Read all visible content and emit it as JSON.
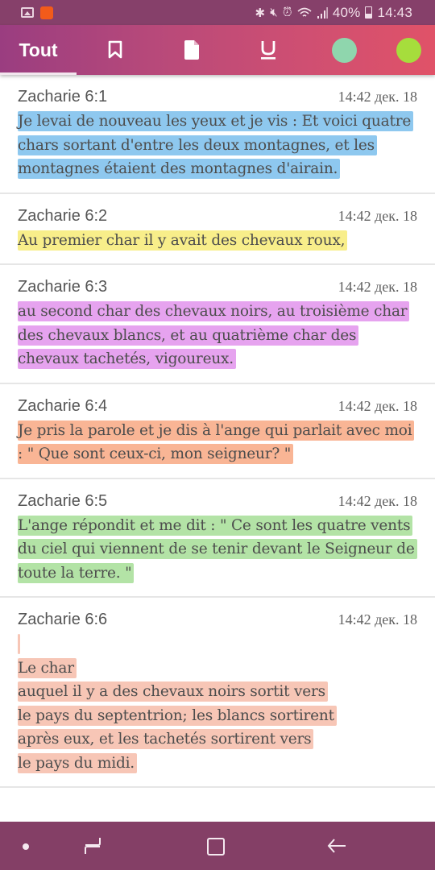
{
  "status_bar": {
    "battery": "40%",
    "time": "14:43",
    "icons": [
      "gallery-icon",
      "app-notification-icon",
      "bluetooth-icon",
      "mute-icon",
      "alarm-icon",
      "wifi-icon",
      "signal-icon",
      "battery-icon"
    ]
  },
  "tabs": [
    {
      "label": "Tout",
      "icon": null,
      "selected": true
    },
    {
      "label": "",
      "icon": "bookmark-icon",
      "selected": false
    },
    {
      "label": "",
      "icon": "note-icon",
      "selected": false
    },
    {
      "label": "",
      "icon": "underline-icon",
      "selected": false
    },
    {
      "label": "",
      "icon": "color-filter-icon",
      "color": "#8fd6ad",
      "selected": false
    },
    {
      "label": "",
      "icon": "color-filter-icon",
      "color": "#a6dd3c",
      "selected": false
    }
  ],
  "colors": {
    "blue": "#8ec8ef",
    "yellow": "#f8ee8a",
    "purple": "#e6a3ef",
    "orange": "#f9b595",
    "green": "#b3e3a6",
    "salmon": "#f7c6b6"
  },
  "items": [
    {
      "ref": "Zacharie 6:1",
      "time": "14:42 дек. 18",
      "highlight": "#8ec8ef",
      "text": "Je levai de nouveau les yeux et je vis : Et voici quatre chars sortant d'entre les deux montagnes, et les montagnes étaient des montagnes d'airain."
    },
    {
      "ref": "Zacharie 6:2",
      "time": "14:42 дек. 18",
      "highlight": "#f8ee8a",
      "text": "Au premier char il y avait des chevaux roux,"
    },
    {
      "ref": "Zacharie 6:3",
      "time": "14:42 дек. 18",
      "highlight": "#e6a3ef",
      "text": "au second char des chevaux noirs, au troisième char des chevaux blancs, et au quatrième char des chevaux tachetés, vigoureux."
    },
    {
      "ref": "Zacharie 6:4",
      "time": "14:42 дек. 18",
      "highlight": "#f9b595",
      "text": "Je pris la parole et je dis à l'ange qui parlait avec moi : \" Que sont ceux-ci, mon seigneur? \""
    },
    {
      "ref": "Zacharie 6:5",
      "time": "14:42 дек. 18",
      "highlight": "#b3e3a6",
      "text": "L'ange répondit et me dit : \" Ce sont les quatre vents du ciel qui viennent de se tenir devant le Seigneur de toute la terre. \""
    },
    {
      "ref": "Zacharie 6:6",
      "time": "14:42 дек. 18",
      "highlight": "#f7c6b6",
      "text": " \nLe char\nauquel il y a des chevaux noirs sortit vers\nle pays du septentrion; les blancs sortirent\naprès eux, et les tachetés sortirent vers\nle pays du midi."
    }
  ],
  "nav_bar": {
    "buttons": [
      "assistant-dot",
      "recents",
      "home",
      "back"
    ]
  }
}
